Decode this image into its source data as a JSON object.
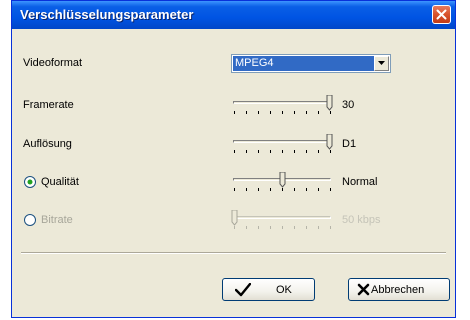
{
  "window": {
    "title": "Verschlüsselungsparameter",
    "close_icon": "close-x-icon"
  },
  "video_format": {
    "label": "Videoformat",
    "selected": "MPEG4"
  },
  "framerate": {
    "label": "Framerate",
    "value": "30",
    "level": 1.0
  },
  "resolution": {
    "label": "Auflösung",
    "value": "D1",
    "level": 1.0
  },
  "quality": {
    "label": "Qualität",
    "value": "Normal",
    "selected": true,
    "level": 0.5
  },
  "bitrate": {
    "label": "Bitrate",
    "value": "50 kbps",
    "selected": false,
    "enabled": false,
    "level": 0.0
  },
  "buttons": {
    "ok_label": "OK",
    "ok_icon": "checkmark-icon",
    "cancel_label": "Abbrechen",
    "cancel_icon": "x-mark-icon"
  },
  "colors": {
    "titlebar": "#0054e3",
    "dialog_bg": "#ece9d8",
    "selection": "#316ac5",
    "close_button": "#d8532c"
  }
}
